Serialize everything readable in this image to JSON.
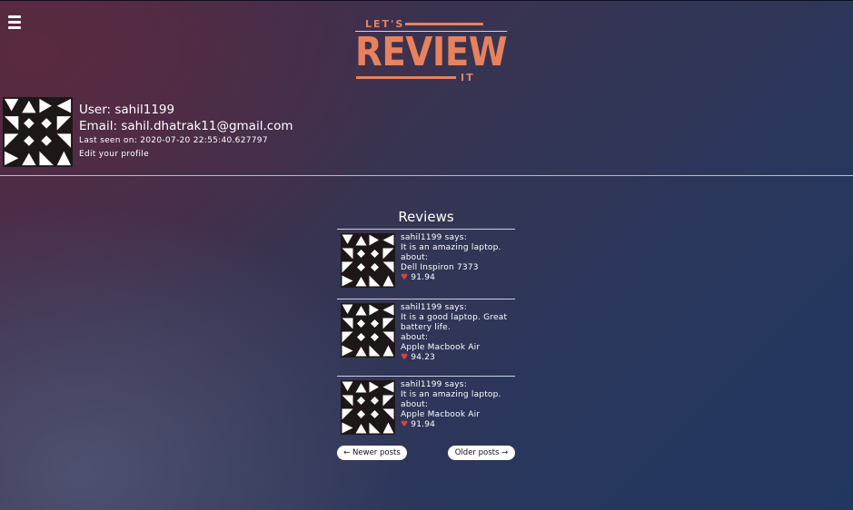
{
  "header": {
    "menu_icon": "hamburger-menu-icon",
    "logo": {
      "top": "LET'S",
      "main": "REVIEW",
      "bottom": "IT",
      "color": "#e8825e"
    }
  },
  "profile": {
    "user_line": "User: sahil1199",
    "email_line": "Email: sahil.dhatrak11@gmail.com",
    "last_seen_line": "Last seen on: 2020-07-20 22:55:40.627797",
    "edit_link": "Edit your profile"
  },
  "reviews_section": {
    "title": "Reviews",
    "items": [
      {
        "says": "sahil1199 says:",
        "body": "It is an amazing laptop.",
        "about_label": "about:",
        "product": "Dell Inspiron 7373",
        "score": "91.94"
      },
      {
        "says": "sahil1199 says:",
        "body": "It is a good laptop. Great battery life.",
        "about_label": "about:",
        "product": "Apple Macbook Air",
        "score": "94.23"
      },
      {
        "says": "sahil1199 says:",
        "body": "It is an amazing laptop.",
        "about_label": "about:",
        "product": "Apple Macbook Air",
        "score": "91.94"
      }
    ]
  },
  "pagination": {
    "newer": "← Newer posts",
    "older": "Older posts →"
  },
  "colors": {
    "heart": "#e0403c",
    "accent": "#e8825e"
  }
}
